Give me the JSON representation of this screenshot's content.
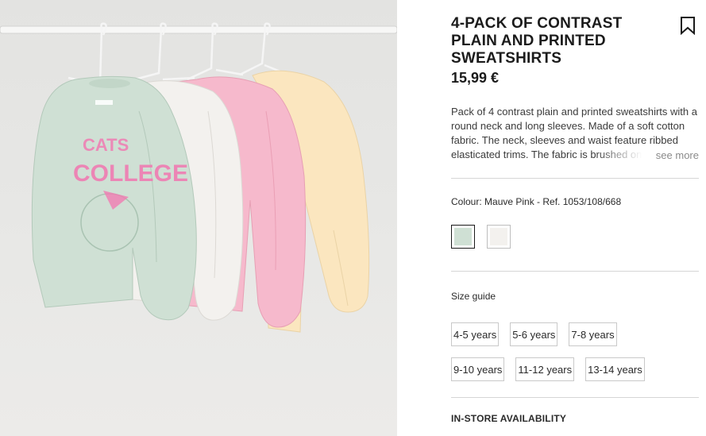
{
  "product": {
    "image_alt": "Four sweatshirts on hangers: mint green with pink print, white, pink and pale yellow",
    "title": "4-PACK OF CONTRAST PLAIN AND PRINTED SWEATSHIRTS",
    "price": "15,99 €",
    "description": "Pack of 4 contrast plain and printed sweatshirts with a round neck and long sleeves. Made of a soft cotton fabric. The neck, sleeves and waist feature ribbed elasticated trims. The fabric is brushed on the inside.",
    "see_more": "see more",
    "bookmark_icon": "bookmark-icon"
  },
  "colour": {
    "line": "Colour: Mauve Pink - Ref. 1053/108/668",
    "swatches": [
      {
        "name": "mint",
        "color": "#cfe0d4",
        "selected": true
      },
      {
        "name": "white",
        "color": "#f3f1ee",
        "selected": false
      }
    ]
  },
  "sizes": {
    "guide_label": "Size guide",
    "row1": [
      "4-5 years",
      "5-6 years",
      "7-8 years"
    ],
    "row2": [
      "9-10 years",
      "11-12 years",
      "13-14 years"
    ]
  },
  "availability": {
    "label": "IN-STORE AVAILABILITY"
  },
  "colors": {
    "text": "#1b1b1b",
    "divider": "#d6d6d6",
    "mint": "#cfe0d4",
    "white": "#f3f1ee",
    "pink": "#f6b9cc",
    "yellow": "#fbe6bf",
    "print_pink": "#f07cb2"
  }
}
